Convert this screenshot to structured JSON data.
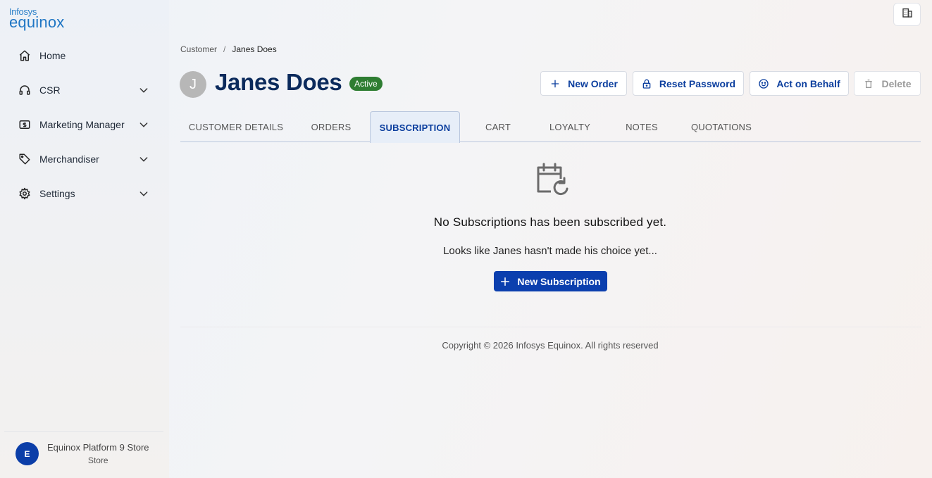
{
  "logo": {
    "line1": "Infosys",
    "line2": "equinox"
  },
  "sidebar": {
    "items": [
      {
        "label": "Home",
        "icon": "home-icon",
        "expandable": false
      },
      {
        "label": "CSR",
        "icon": "headset-icon",
        "expandable": true
      },
      {
        "label": "Marketing Manager",
        "icon": "dollar-card-icon",
        "expandable": true
      },
      {
        "label": "Merchandiser",
        "icon": "tag-icon",
        "expandable": true
      },
      {
        "label": "Settings",
        "icon": "gear-icon",
        "expandable": true
      }
    ],
    "store": {
      "avatar_letter": "E",
      "name": "Equinox Platform 9 Store",
      "type": "Store"
    }
  },
  "breadcrumb": {
    "parent": "Customer",
    "separator": "/",
    "current": "Janes Does"
  },
  "customer": {
    "initial": "J",
    "name": "Janes Does",
    "status": "Active"
  },
  "header_actions": {
    "new_order": "New Order",
    "reset_password": "Reset Password",
    "act_on_behalf": "Act on Behalf",
    "delete": "Delete"
  },
  "tabs": [
    {
      "label": "CUSTOMER DETAILS",
      "active": false
    },
    {
      "label": "ORDERS",
      "active": false
    },
    {
      "label": "SUBSCRIPTION",
      "active": true
    },
    {
      "label": "CART",
      "active": false
    },
    {
      "label": "LOYALTY",
      "active": false
    },
    {
      "label": "NOTES",
      "active": false
    },
    {
      "label": "QUOTATIONS",
      "active": false
    }
  ],
  "empty_state": {
    "icon": "calendar-refresh-icon",
    "title": "No Subscriptions has been subscribed yet.",
    "subtitle": "Looks like Janes hasn't made his choice yet...",
    "button": "New Subscription"
  },
  "footer": {
    "copyright": "Copyright © 2026 Infosys Equinox. All rights reserved"
  },
  "colors": {
    "primary": "#0b3fae",
    "active_badge": "#2e7d32",
    "title": "#0b2a5c"
  }
}
